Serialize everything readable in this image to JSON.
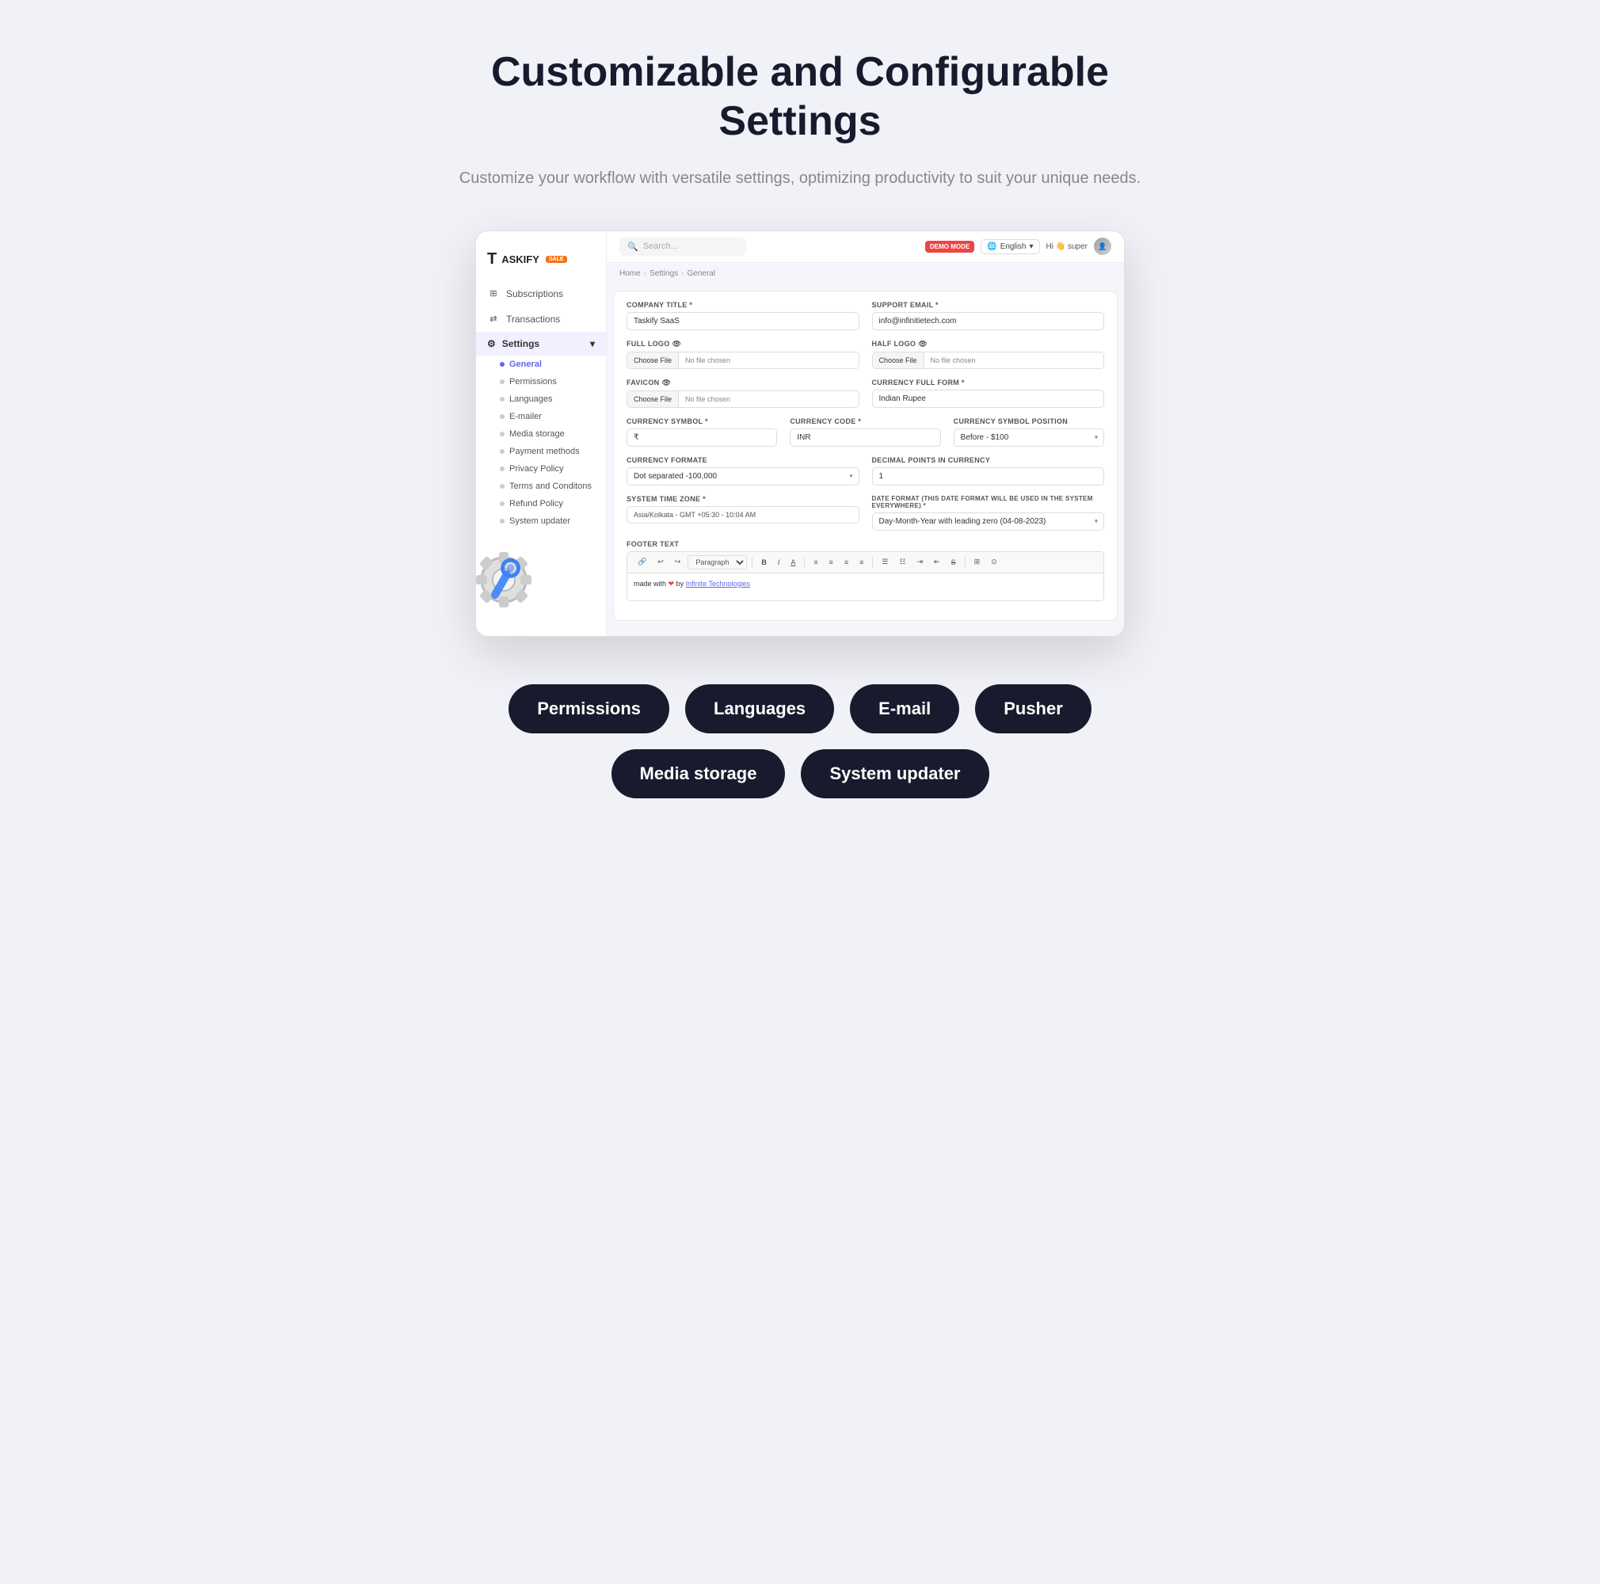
{
  "hero": {
    "title": "Customizable and Configurable Settings",
    "subtitle": "Customize your workflow with versatile settings, optimizing productivity to suit your unique needs."
  },
  "topnav": {
    "search_placeholder": "Search...",
    "demo_badge": "DEMO MODE",
    "lang": "English",
    "greeting": "Hi 👋 super"
  },
  "breadcrumb": {
    "home": "Home",
    "settings": "Settings",
    "general": "General"
  },
  "sidebar": {
    "logo": "TASKIFY",
    "logo_badge": "SALE",
    "items": [
      {
        "label": "Subscriptions",
        "icon": "grid"
      },
      {
        "label": "Transactions",
        "icon": "swap"
      }
    ],
    "settings_label": "Settings",
    "submenu": [
      {
        "label": "General",
        "active": true
      },
      {
        "label": "Permissions",
        "active": false
      },
      {
        "label": "Languages",
        "active": false
      },
      {
        "label": "E-mailer",
        "active": false
      },
      {
        "label": "Media storage",
        "active": false
      },
      {
        "label": "Payment methods",
        "active": false
      },
      {
        "label": "Privacy Policy",
        "active": false
      },
      {
        "label": "Terms and Conditons",
        "active": false
      },
      {
        "label": "Refund Policy",
        "active": false
      },
      {
        "label": "System updater",
        "active": false
      }
    ]
  },
  "form": {
    "company_title_label": "COMPANY TITLE *",
    "company_title_value": "Taskify SaaS",
    "support_email_label": "SUPPORT EMAIL *",
    "support_email_value": "info@infinitietech.com",
    "full_logo_label": "FULL LOGO",
    "full_logo_btn": "Choose File",
    "full_logo_placeholder": "No file chosen",
    "half_logo_label": "HALF LOGO",
    "half_logo_btn": "Choose File",
    "half_logo_placeholder": "No file chosen",
    "favicon_label": "FAVICON",
    "favicon_btn": "Choose File",
    "favicon_placeholder": "No file chosen",
    "currency_full_form_label": "CURRENCY FULL FORM *",
    "currency_full_form_value": "Indian Rupee",
    "currency_symbol_label": "CURRENCY SYMBOL *",
    "currency_symbol_value": "₹",
    "currency_code_label": "CURRENCY CODE *",
    "currency_code_value": "INR",
    "currency_symbol_position_label": "CURRENCY SYMBOL POSITION",
    "currency_symbol_position_value": "Before - $100",
    "currency_formate_label": "CURRENCY FORMATE",
    "currency_formate_value": "Dot separated -100,000",
    "decimal_points_label": "DECIMAL POINTS IN CURRENCY",
    "decimal_points_value": "1",
    "system_timezone_label": "SYSTEM TIME ZONE *",
    "system_timezone_value": "Asia/Kolkata  -  GMT  +05:30  -  10:04 AM",
    "date_format_label": "DATE FORMAT (THIS DATE FORMAT WILL BE USED IN THE SYSTEM EVERYWHERE) *",
    "date_format_value": "Day-Month-Year with leading zero (04-08-2023)",
    "footer_text_label": "FOOTER TEXT",
    "footer_content": "made with ❤ by Infinite Technologies"
  },
  "badges": {
    "row1": [
      "Permissions",
      "Languages",
      "E-mail",
      "Pusher"
    ],
    "row2": [
      "Media storage",
      "System updater"
    ]
  }
}
